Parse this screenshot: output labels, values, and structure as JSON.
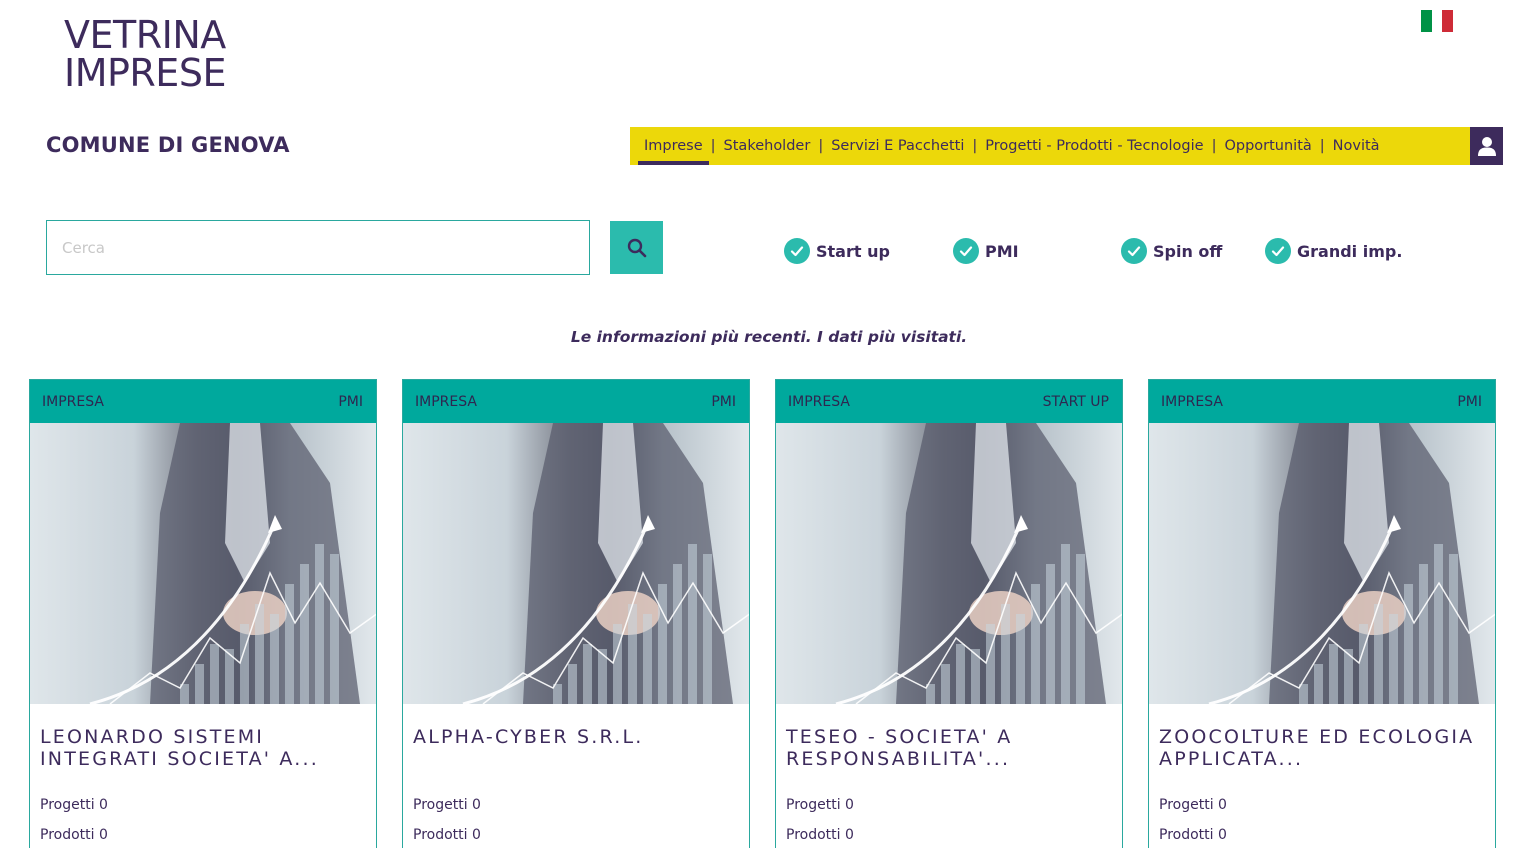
{
  "logo": {
    "line1": "VETRINA",
    "line2": "IMPRESE"
  },
  "language_flag": {
    "colors": [
      "#009246",
      "#ffffff",
      "#ce2b37"
    ]
  },
  "comune": "COMUNE DI GENOVA",
  "nav": {
    "items": [
      {
        "label": "Imprese"
      },
      {
        "label": "Stakeholder"
      },
      {
        "label": "Servizi E Pacchetti"
      },
      {
        "label": "Progetti - Prodotti - Tecnologie"
      },
      {
        "label": "Opportunità"
      },
      {
        "label": "Novità"
      }
    ],
    "separator": "|",
    "accent": "#ecd80a"
  },
  "search": {
    "placeholder": "Cerca"
  },
  "filters": [
    {
      "label": "Start up"
    },
    {
      "label": "PMI"
    },
    {
      "label": "Spin off"
    },
    {
      "label": "Grandi imp."
    }
  ],
  "subtitle": "Le informazioni più recenti. I dati più visitati.",
  "cards": [
    {
      "type": "IMPRESA",
      "category": "PMI",
      "title": "LEONARDO SISTEMI INTEGRATI SOCIETA' A...",
      "progetti": "Progetti 0",
      "prodotti": "Prodotti 0"
    },
    {
      "type": "IMPRESA",
      "category": "PMI",
      "title": "ALPHA-CYBER S.R.L.",
      "progetti": "Progetti 0",
      "prodotti": "Prodotti 0"
    },
    {
      "type": "IMPRESA",
      "category": "START UP",
      "title": "TESEO - SOCIETA' A RESPONSABILITA'...",
      "progetti": "Progetti 0",
      "prodotti": "Prodotti 0"
    },
    {
      "type": "IMPRESA",
      "category": "PMI",
      "title": "ZOOCOLTURE ED ECOLOGIA APPLICATA...",
      "progetti": "Progetti 0",
      "prodotti": "Prodotti 0"
    }
  ],
  "colors": {
    "primary": "#3d2b5c",
    "teal": "#00a99d",
    "yellow": "#ecd80a"
  }
}
